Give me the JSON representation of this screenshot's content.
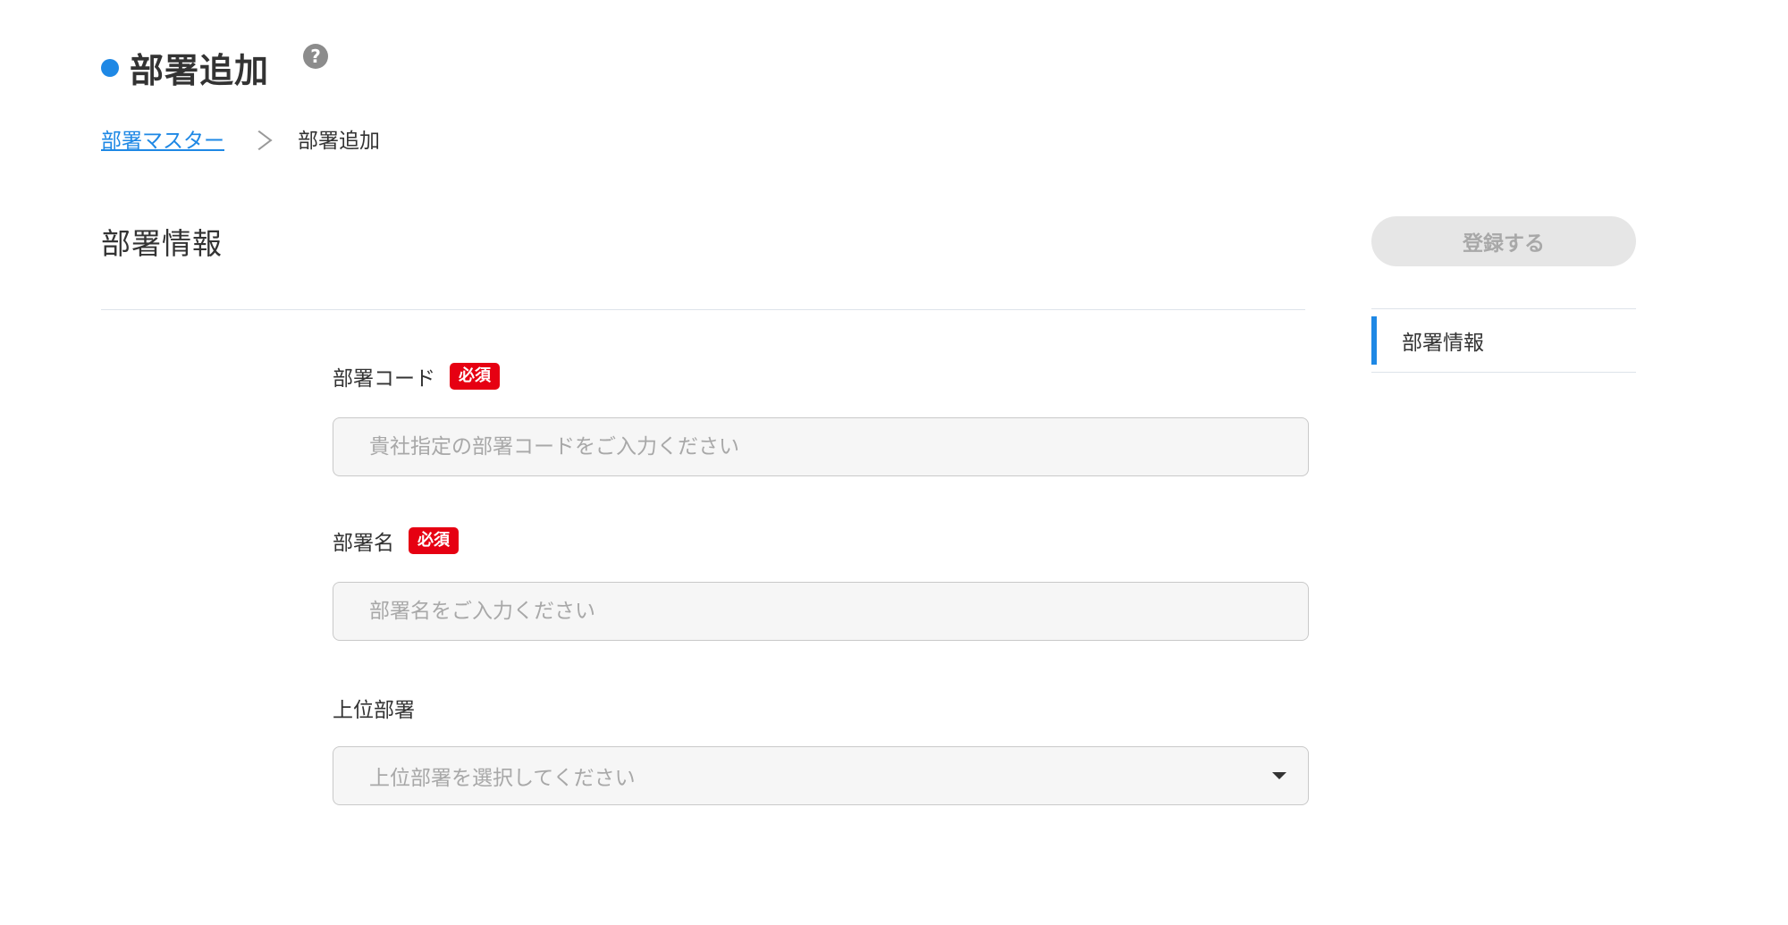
{
  "page": {
    "title": "部署追加",
    "help_symbol": "?"
  },
  "breadcrumb": {
    "parent_label": "部署マスター",
    "current_label": "部署追加"
  },
  "section": {
    "title": "部署情報"
  },
  "form": {
    "required_label": "必須",
    "department_code": {
      "label": "部署コード",
      "value": "",
      "placeholder": "貴社指定の部署コードをご入力ください"
    },
    "department_name": {
      "label": "部署名",
      "value": "",
      "placeholder": "部署名をご入力ください"
    },
    "parent_department": {
      "label": "上位部署",
      "selected_value": "上位部署を選択してください"
    }
  },
  "actions": {
    "submit_label": "登録する"
  },
  "side_nav": {
    "items": [
      {
        "label": "部署情報",
        "active": true
      }
    ]
  },
  "colors": {
    "accent": "#1e88e5",
    "required_badge": "#e60012",
    "disabled_button_bg": "#e6e6e6",
    "disabled_button_text": "#a8a8a8",
    "input_bg": "#f6f6f6"
  },
  "icons": {
    "title_marker": "dot-icon",
    "help": "question-circle-icon",
    "breadcrumb_separator": "chevron-right-icon",
    "select_caret": "caret-down-icon"
  }
}
